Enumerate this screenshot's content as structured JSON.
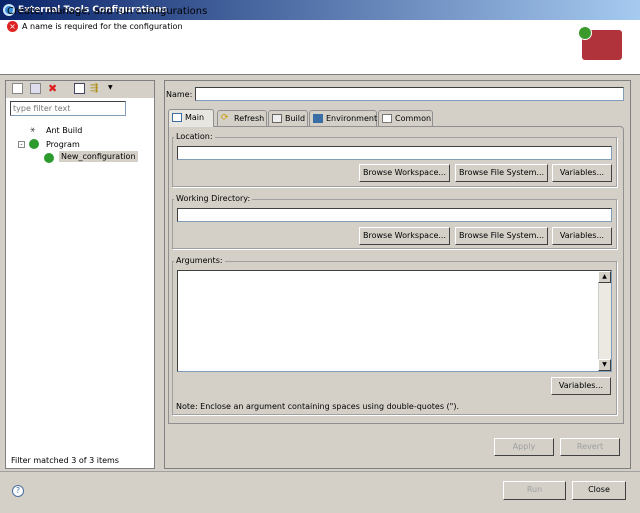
{
  "window": {
    "title": "External Tools Configurations"
  },
  "header": {
    "title": "Create, manage, and run configurations",
    "error": "A name is required for the configuration"
  },
  "sidebar": {
    "filter_placeholder": "type filter text",
    "tree": [
      {
        "label": "Ant Build"
      },
      {
        "label": "Program"
      },
      {
        "label": "New_configuration"
      }
    ],
    "status": "Filter matched 3 of 3 items"
  },
  "main": {
    "name_label": "Name:",
    "name_value": "",
    "tabs": [
      {
        "label": "Main"
      },
      {
        "label": "Refresh"
      },
      {
        "label": "Build"
      },
      {
        "label": "Environment"
      },
      {
        "label": "Common"
      }
    ],
    "location": {
      "label": "Location:",
      "value": "",
      "browse_workspace": "Browse Workspace...",
      "browse_fs": "Browse File System...",
      "variables": "Variables..."
    },
    "working_dir": {
      "label": "Working Directory:",
      "value": "",
      "browse_workspace": "Browse Workspace...",
      "browse_fs": "Browse File System...",
      "variables": "Variables..."
    },
    "arguments": {
      "label": "Arguments:",
      "value": "",
      "variables": "Variables...",
      "note": "Note: Enclose an argument containing spaces using double-quotes (\")."
    },
    "apply": "Apply",
    "revert": "Revert"
  },
  "footer": {
    "run": "Run",
    "close": "Close",
    "help": "?"
  }
}
